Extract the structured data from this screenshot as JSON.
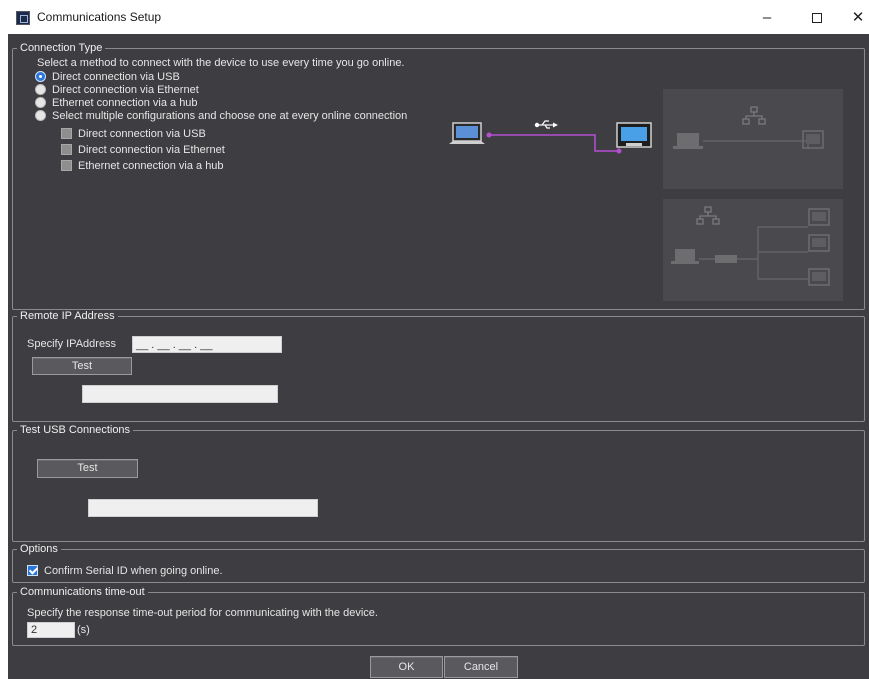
{
  "window": {
    "title": "Communications Setup",
    "minimize_glyph": "–",
    "close_glyph": "✕"
  },
  "connection_type": {
    "legend": "Connection Type",
    "instruction": "Select a method to connect with the device to use every time you go online.",
    "options": [
      {
        "label": "Direct connection via USB",
        "selected": true
      },
      {
        "label": "Direct connection via Ethernet",
        "selected": false
      },
      {
        "label": "Ethernet connection via a hub",
        "selected": false
      },
      {
        "label": "Select multiple configurations and choose one at every online connection",
        "selected": false
      }
    ],
    "multi_options": [
      {
        "label": "Direct connection via USB",
        "checked": false
      },
      {
        "label": "Direct connection via Ethernet",
        "checked": false
      },
      {
        "label": "Ethernet connection via a hub",
        "checked": false
      }
    ],
    "diagram": {
      "usb_symbol": "•⟜",
      "line_color": "#b54fd1"
    }
  },
  "remote_ip": {
    "legend": "Remote IP Address",
    "specify_label": "Specify IPAddress",
    "ip_value": "__ . __ . __ . __",
    "test_label": "Test"
  },
  "test_usb": {
    "legend": "Test USB Connections",
    "test_label": "Test"
  },
  "options": {
    "legend": "Options",
    "confirm_serial_label": "Confirm Serial ID when going online.",
    "confirm_serial_checked": true
  },
  "timeout": {
    "legend": "Communications time-out",
    "instruction": "Specify the response time-out period for communicating with the device.",
    "value": "2",
    "unit": "(s)"
  },
  "footer": {
    "ok_label": "OK",
    "cancel_label": "Cancel"
  },
  "colors": {
    "dialog_bg": "#3e3e42",
    "accent": "#2b78d8",
    "link_line": "#b54fd1"
  }
}
